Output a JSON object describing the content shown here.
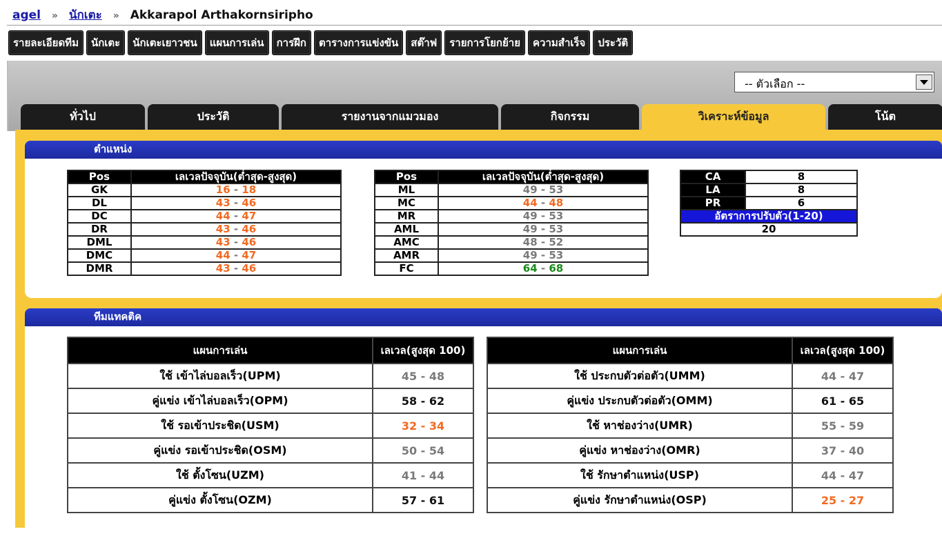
{
  "breadcrumb": {
    "root": "agel",
    "section": "นักเตะ",
    "player": "Akkarapol Arthakornsiripho"
  },
  "nav": [
    "รายละเอียดทีม",
    "นักเตะ",
    "นักเตะเยาวชน",
    "แผนการเล่น",
    "การฝึก",
    "ตารางการแข่งขัน",
    "สต๊าฟ",
    "รายการโยกย้าย",
    "ความสำเร็จ",
    "ประวัติ"
  ],
  "options": {
    "selected": "-- ตัวเลือก --"
  },
  "tabs": [
    "ทั่วไป",
    "ประวัติ",
    "รายงานจากแมวมอง",
    "กิจกรรม",
    "วิเคราะห์ข้อมูล",
    "โน้ต"
  ],
  "position": {
    "title": "ตำแหน่ง",
    "headers": [
      "Pos",
      "เลเวลปัจจุบัน(ต่ำสุด-สูงสุด)"
    ],
    "left": [
      {
        "pos": "GK",
        "min": "16",
        "max": "18",
        "color": "o"
      },
      {
        "pos": "DL",
        "min": "43",
        "max": "46",
        "color": "o"
      },
      {
        "pos": "DC",
        "min": "44",
        "max": "47",
        "color": "o"
      },
      {
        "pos": "DR",
        "min": "43",
        "max": "46",
        "color": "o"
      },
      {
        "pos": "DML",
        "min": "43",
        "max": "46",
        "color": "o"
      },
      {
        "pos": "DMC",
        "min": "44",
        "max": "47",
        "color": "o"
      },
      {
        "pos": "DMR",
        "min": "43",
        "max": "46",
        "color": "o"
      }
    ],
    "right": [
      {
        "pos": "ML",
        "min": "49",
        "max": "53",
        "color": "g"
      },
      {
        "pos": "MC",
        "min": "44",
        "max": "48",
        "color": "o"
      },
      {
        "pos": "MR",
        "min": "49",
        "max": "53",
        "color": "g"
      },
      {
        "pos": "AML",
        "min": "49",
        "max": "53",
        "color": "g"
      },
      {
        "pos": "AMC",
        "min": "48",
        "max": "52",
        "color": "g"
      },
      {
        "pos": "AMR",
        "min": "49",
        "max": "53",
        "color": "g"
      },
      {
        "pos": "FC",
        "min": "64",
        "max": "68",
        "color": "gr"
      }
    ],
    "attributes": [
      {
        "label": "CA",
        "value": "8"
      },
      {
        "label": "LA",
        "value": "8"
      },
      {
        "label": "PR",
        "value": "6"
      }
    ],
    "adapt_label": "อัตราการปรับตัว(1-20)",
    "adapt_value": "20"
  },
  "tactics": {
    "title": "ทีมแทคติค",
    "headers": [
      "แผนการเล่น",
      "เลเวล(สูงสุด 100)"
    ],
    "left": [
      {
        "name": "ใช้ เข้าไล่บอลเร็ว(UPM)",
        "min": "45",
        "max": "48",
        "color": "g"
      },
      {
        "name": "คู่แข่ง เข้าไล่บอลเร็ว(OPM)",
        "min": "58",
        "max": "62",
        "color": "k"
      },
      {
        "name": "ใช้ รอเข้าประชิด(USM)",
        "min": "32",
        "max": "34",
        "color": "o"
      },
      {
        "name": "คู่แข่ง รอเข้าประชิด(OSM)",
        "min": "50",
        "max": "54",
        "color": "g"
      },
      {
        "name": "ใช้ ตั้งโซน(UZM)",
        "min": "41",
        "max": "44",
        "color": "g"
      },
      {
        "name": "คู่แข่ง ตั้งโซน(OZM)",
        "min": "57",
        "max": "61",
        "color": "k"
      }
    ],
    "right": [
      {
        "name": "ใช้ ประกบตัวต่อตัว(UMM)",
        "min": "44",
        "max": "47",
        "color": "g"
      },
      {
        "name": "คู่แข่ง ประกบตัวต่อตัว(OMM)",
        "min": "61",
        "max": "65",
        "color": "k"
      },
      {
        "name": "ใช้ หาช่องว่าง(UMR)",
        "min": "55",
        "max": "59",
        "color": "g"
      },
      {
        "name": "คู่แข่ง หาช่องว่าง(OMR)",
        "min": "37",
        "max": "40",
        "color": "g"
      },
      {
        "name": "ใช้ รักษาตำแหน่ง(USP)",
        "min": "44",
        "max": "47",
        "color": "g"
      },
      {
        "name": "คู่แข่ง รักษาตำแหน่ง(OSP)",
        "min": "25",
        "max": "27",
        "color": "o"
      }
    ]
  },
  "colors": {
    "accent_yellow": "#f7c93a",
    "header_blue": "#1d2aa0",
    "orange": "#f26a21",
    "green": "#1a8a1a"
  }
}
